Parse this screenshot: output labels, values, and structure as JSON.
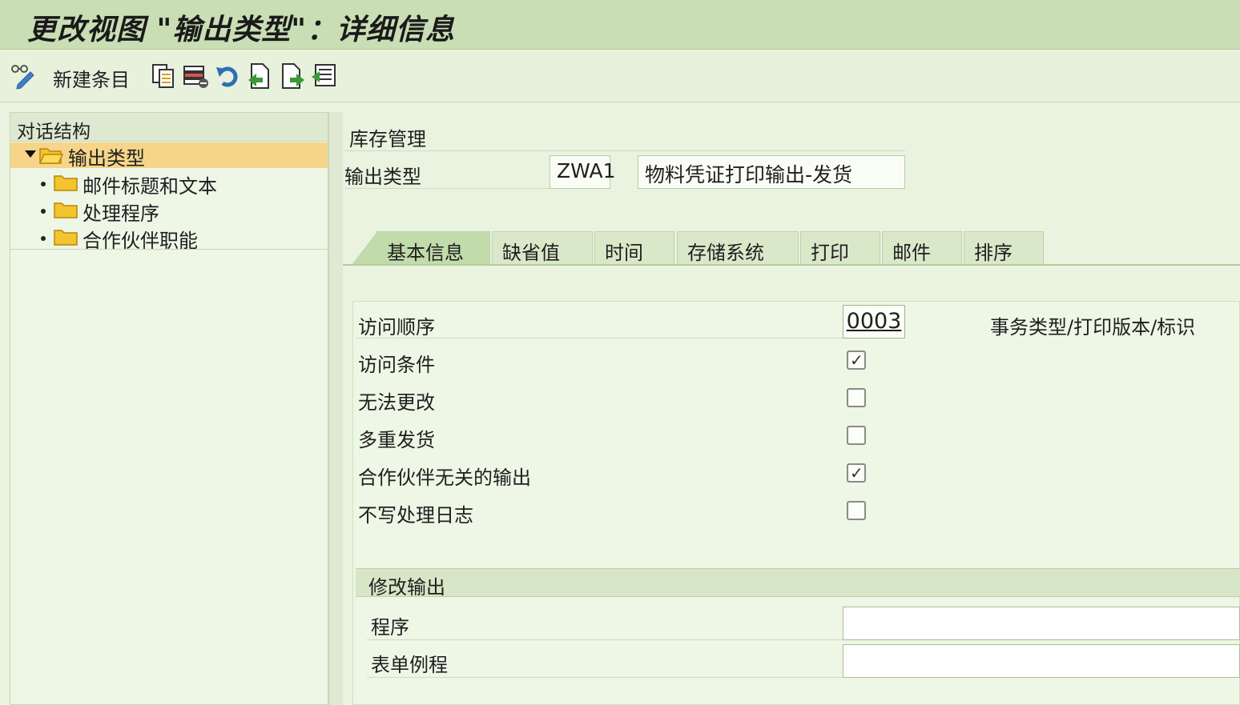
{
  "window": {
    "title": "更改视图 \"输出类型\"：详细信息"
  },
  "toolbar": {
    "new_entry_label": "新建条目",
    "icons": [
      "edit-glasses-icon",
      "copy-icon",
      "delete-icon",
      "undo-icon",
      "previous-entry-icon",
      "next-entry-icon",
      "select-block-icon"
    ]
  },
  "dialog_structure": {
    "header": "对话结构",
    "items": [
      {
        "label": "输出类型",
        "selected": true,
        "expanded": true
      },
      {
        "label": "邮件标题和文本"
      },
      {
        "label": "处理程序"
      },
      {
        "label": "合作伙伴职能"
      }
    ]
  },
  "header_fields": {
    "application_label": "库存管理",
    "output_type_label": "输出类型",
    "output_type_code": "ZWA1",
    "output_type_description": "物料凭证打印输出-发货"
  },
  "tabs": [
    {
      "label": "基本信息",
      "active": true
    },
    {
      "label": "缺省值"
    },
    {
      "label": "时间"
    },
    {
      "label": "存储系统"
    },
    {
      "label": "打印"
    },
    {
      "label": "邮件"
    },
    {
      "label": "排序"
    }
  ],
  "basic_info": {
    "access_sequence_label": "访问顺序",
    "access_sequence_value": "0003",
    "access_sequence_desc": "事务类型/打印版本/标识",
    "checkboxes": [
      {
        "label": "访问条件",
        "checked": true
      },
      {
        "label": "无法更改",
        "checked": false
      },
      {
        "label": "多重发货",
        "checked": false
      },
      {
        "label": "合作伙伴无关的输出",
        "checked": true
      },
      {
        "label": "不写处理日志",
        "checked": false
      }
    ]
  },
  "change_output": {
    "header": "修改输出",
    "program_label": "程序",
    "program_value": "",
    "form_routine_label": "表单例程",
    "form_routine_value": ""
  }
}
